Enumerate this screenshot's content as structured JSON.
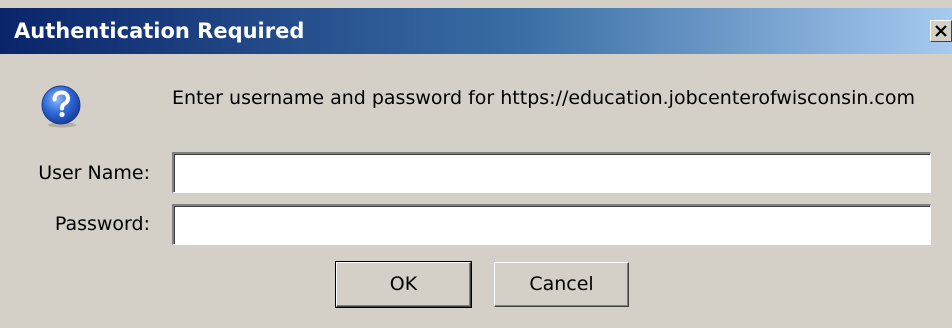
{
  "window": {
    "title": "Authentication Required",
    "close_glyph": "✕",
    "colors": {
      "titlebar_start": "#0a246a",
      "titlebar_end": "#a6caf0",
      "dialog_bg": "#d4d0c8"
    }
  },
  "prompt": {
    "icon": "question-icon",
    "message": "Enter username and password for https://education.jobcenterofwisconsin.com"
  },
  "form": {
    "username_label": "User Name:",
    "username_value": "",
    "password_label": "Password:",
    "password_value": ""
  },
  "buttons": {
    "ok_label": "OK",
    "cancel_label": "Cancel"
  }
}
